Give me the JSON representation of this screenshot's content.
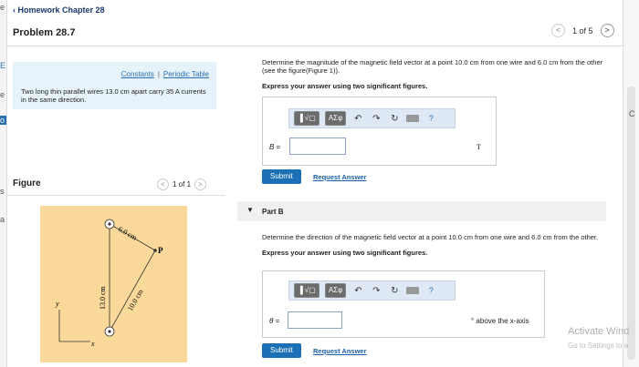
{
  "nav": {
    "back_label": "Homework Chapter 28",
    "problem_title": "Problem 28.7",
    "pager": {
      "current": "1 of 5",
      "prev": "<",
      "next": ">"
    }
  },
  "info": {
    "constants_link": "Constants",
    "separator": "|",
    "periodic_link": "Periodic Table",
    "problem_text": "Two long thin parallel wires 13.0 cm apart carry 35 A currents in the same direction."
  },
  "figure": {
    "label": "Figure",
    "pager": "1 of 1",
    "prev": "<",
    "next": ">",
    "labels": {
      "d1": "6.0 cm",
      "d2": "13.0 cm",
      "d3": "10.0 cm",
      "point": "P",
      "x": "x",
      "y": "y"
    },
    "colors": {
      "background": "#fbd99a",
      "lines": "#333333"
    }
  },
  "part_a": {
    "question": "Determine the magnitude of the magnetic field vector at a point 10.0 cm from one wire and 6.0 cm from the other (see the figure(Figure 1)).",
    "instruction": "Express your answer using two significant figures.",
    "toolbar": {
      "template_btn": "▐ √▢",
      "greek_btn": "ΑΣφ",
      "help": "?"
    },
    "variable": "B =",
    "input_value": "",
    "unit": "T",
    "submit": "Submit",
    "request": "Request Answer"
  },
  "part_b": {
    "header": "Part B",
    "question": "Determine the direction of the magnetic field vector at a point 10.0 cm from one wire and 6.0 cm from the other.",
    "instruction": "Express your answer using two significant figures.",
    "toolbar": {
      "template_btn": "▐ √▢",
      "greek_btn": "ΑΣφ",
      "help": "?"
    },
    "variable": "θ =",
    "input_value": "",
    "unit": "° above the x-axis",
    "submit": "Submit",
    "request": "Request Answer"
  },
  "os_overlay": {
    "line1": "Activate Wind",
    "line2": "Go to Settings to a"
  },
  "edge": {
    "left_chars": [
      "e",
      "E",
      "e",
      "o",
      "s",
      "a"
    ],
    "right_char": "C"
  },
  "colors": {
    "accent": "#1a6fb5",
    "info_bg": "#e7f3fa",
    "toolbar_bg": "#dfe9f5"
  }
}
